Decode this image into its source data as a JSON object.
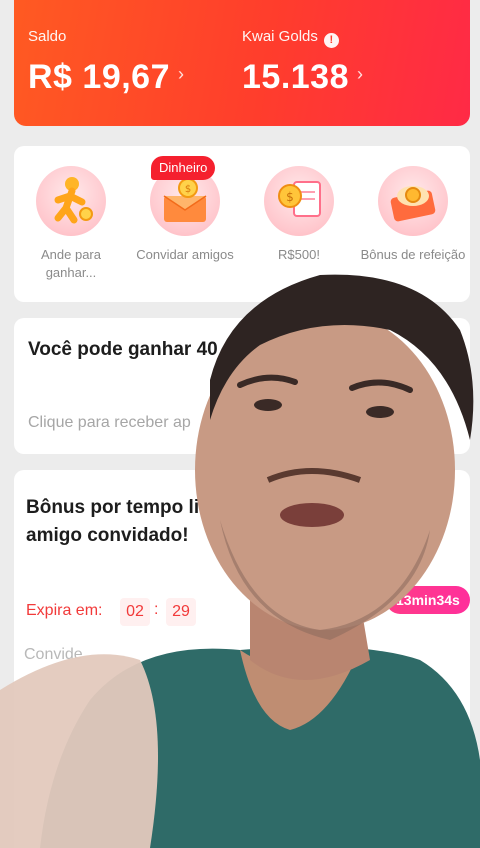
{
  "balance": {
    "saldo_label": "Saldo",
    "saldo_value": "R$ 19,67",
    "golds_label": "Kwai Golds",
    "golds_value": "15.138",
    "chevron": "›",
    "info_icon": "!"
  },
  "features": {
    "badge": "Dinheiro",
    "items": [
      {
        "label": "Ande para ganhar...",
        "icon": "walking-figure-icon"
      },
      {
        "label": "Convidar amigos",
        "icon": "envelope-coin-icon"
      },
      {
        "label": "R$500!",
        "icon": "coin-document-icon"
      },
      {
        "label": "Bônus de refeição",
        "icon": "food-plate-icon"
      }
    ]
  },
  "earn": {
    "title": "Você pode ganhar 40 Golds na hora de co",
    "subtitle": "Clique para receber ap"
  },
  "bonus": {
    "title": "Bônus por tempo li Ganhe até R$34,00 amigo convidado!",
    "expira_label": "Expira em:",
    "timer": [
      "02",
      "29"
    ],
    "timer_sep": ":",
    "subtitle": "Convide",
    "pill": "13min34s"
  },
  "colors": {
    "accent_red": "#ff3d2c",
    "badge_red": "#f5202e",
    "timer_red": "#f23a3a",
    "pill_pink": "#ff3b88"
  }
}
